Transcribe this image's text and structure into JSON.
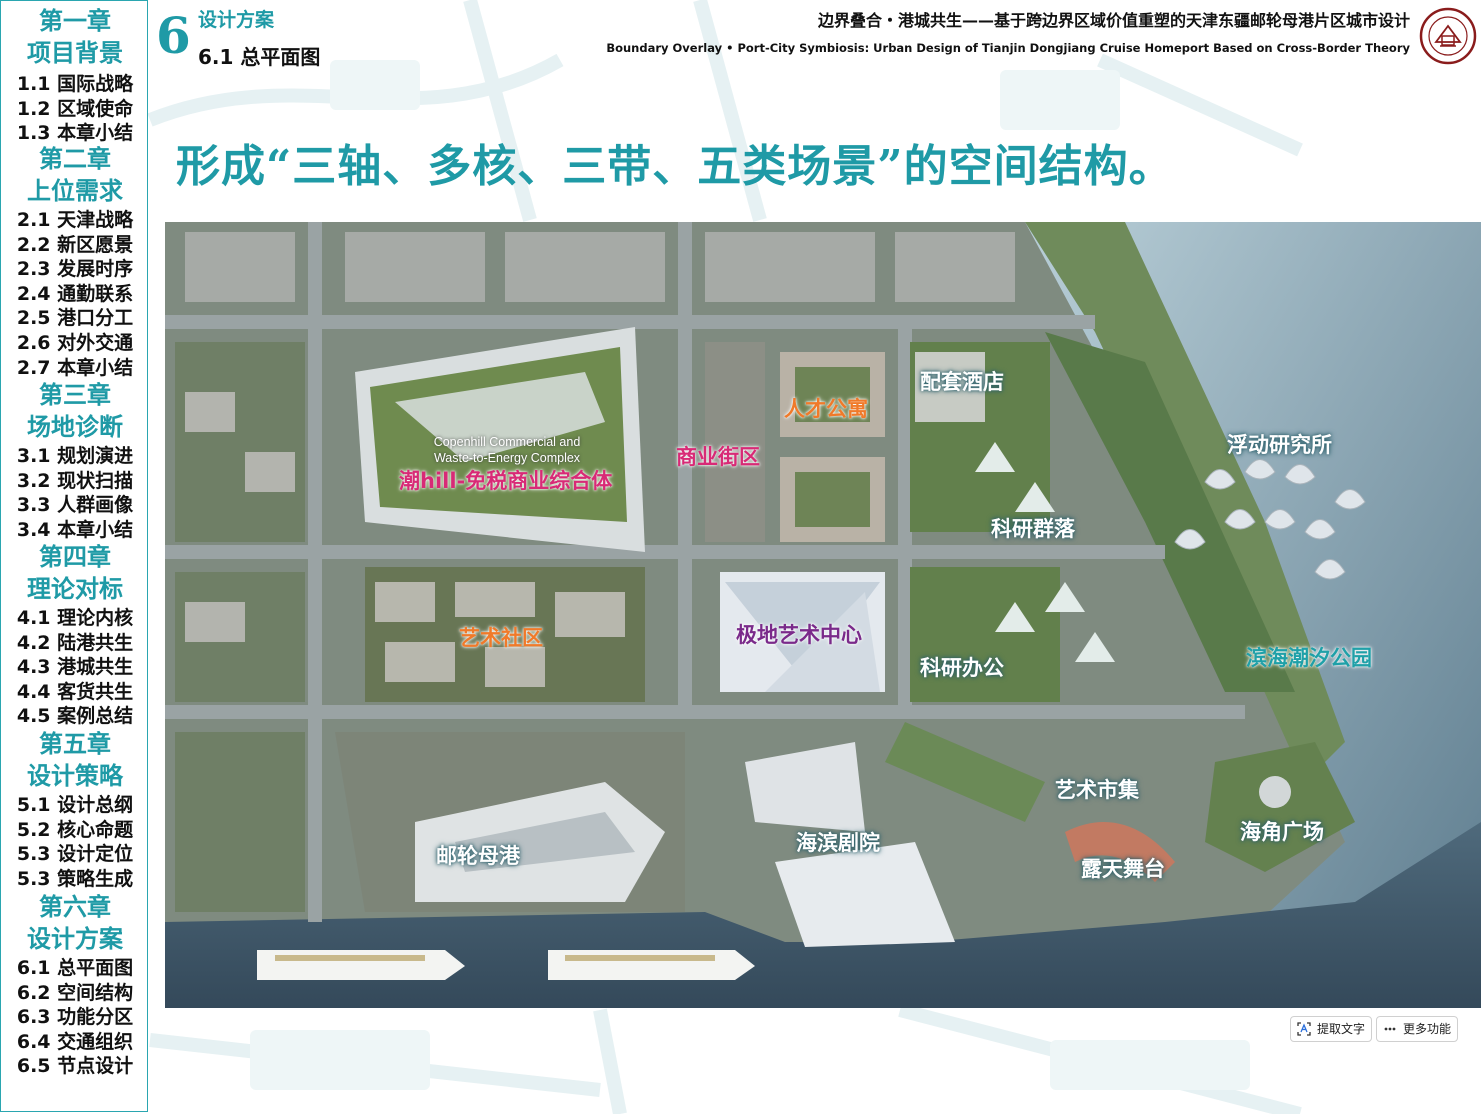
{
  "sidebar": {
    "chapters": [
      {
        "title": "第一章",
        "name": "项目背景",
        "items": [
          "1.1 国际战略",
          "1.2 区域使命",
          "1.3 本章小结"
        ]
      },
      {
        "title": "第二章",
        "name": "上位需求",
        "items": [
          "2.1 天津战略",
          "2.2 新区愿景",
          "2.3 发展时序",
          "2.4 通勤联系",
          "2.5 港口分工",
          "2.6 对外交通",
          "2.7 本章小结"
        ]
      },
      {
        "title": "第三章",
        "name": "场地诊断",
        "items": [
          "3.1 规划演进",
          "3.2 现状扫描",
          "3.3 人群画像",
          "3.4 本章小结"
        ]
      },
      {
        "title": "第四章",
        "name": "理论对标",
        "items": [
          "4.1 理论内核",
          "4.2 陆港共生",
          "4.3 港城共生",
          "4.4 客货共生",
          "4.5 案例总结"
        ]
      },
      {
        "title": "第五章",
        "name": "设计策略",
        "items": [
          "5.1 设计总纲",
          "5.2 核心命题",
          "5.3 设计定位",
          "5.3 策略生成"
        ]
      },
      {
        "title": "第六章",
        "name": "设计方案",
        "items": [
          "6.1 总平面图",
          "6.2 空间结构",
          "6.3 功能分区",
          "6.4 交通组织",
          "6.5 节点设计"
        ]
      }
    ]
  },
  "header": {
    "section_number": "6",
    "section_title": "设计方案",
    "sub_title": "6.1 总平面图",
    "project_title_cn": "边界叠合・港城共生——基于跨边界区域价值重塑的天津东疆邮轮母港片区城市设计",
    "project_title_en": "Boundary Overlay • Port-City Symbiosis: Urban Design of Tianjin Dongjiang Cruise Homeport Based on Cross-Border Theory",
    "headline": "形成“三轴、多核、三带、五类场景”的空间结构。"
  },
  "plan_labels": {
    "copenhill_en_line1": "Copenhill Commercial and",
    "copenhill_en_line2": "Waste-to-Energy Complex",
    "copenhill": "潮hill-免税商业综合体",
    "commercial_street": "商业街区",
    "talent_apartment": "人才公寓",
    "hotel": "配套酒店",
    "floating_lab": "浮动研究所",
    "research_cluster": "科研群落",
    "art_community": "艺术社区",
    "polar_art_center": "极地艺术中心",
    "research_office": "科研办公",
    "tidal_park": "滨海潮汐公园",
    "art_market": "艺术市集",
    "cape_plaza": "海角广场",
    "cruise_port": "邮轮母港",
    "theater": "海滨剧院",
    "open_stage": "露天舞台"
  },
  "toolbar": {
    "extract_text": "提取文字",
    "more": "更多功能"
  },
  "colors": {
    "accent": "#1f9aa6",
    "orange_label": "#f07a2a",
    "pink_label": "#d82a76",
    "violet_label": "#7a2a8a"
  }
}
